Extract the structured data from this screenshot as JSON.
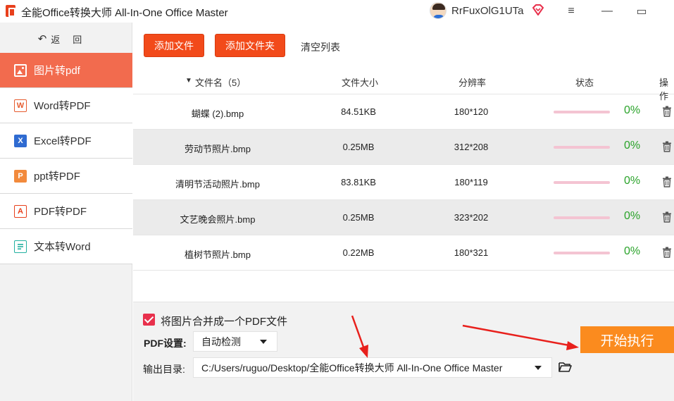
{
  "window": {
    "title": "全能Office转换大师 All-In-One Office Master",
    "username": "RrFuxOlG1UTa",
    "menu_icon": "≡",
    "minimize_icon": "—",
    "maximize_icon": "▭"
  },
  "sidebar": {
    "back_icon": "↶",
    "back_label": "返回",
    "items": [
      {
        "label": "图片转pdf",
        "icon": "image-icon",
        "color": "#ffffff",
        "active": true
      },
      {
        "label": "Word转PDF",
        "icon": "word-icon",
        "icon_text": "W",
        "color": "#e65c2f",
        "active": false
      },
      {
        "label": "Excel转PDF",
        "icon": "excel-icon",
        "icon_text": "X",
        "color": "#2f6bd1",
        "active": false
      },
      {
        "label": "ppt转PDF",
        "icon": "ppt-icon",
        "icon_text": "P",
        "color": "#f28a3c",
        "active": false
      },
      {
        "label": "PDF转PDF",
        "icon": "pdf-icon",
        "icon_text": "A",
        "color": "#e8401c",
        "active": false
      },
      {
        "label": "文本转Word",
        "icon": "text-icon",
        "icon_text": "",
        "color": "#22b0a0",
        "active": false
      }
    ]
  },
  "toolbar": {
    "add_file": "添加文件",
    "add_folder": "添加文件夹",
    "clear_list": "清空列表"
  },
  "table": {
    "sort_icon": "▼",
    "columns": {
      "name": "文件名（5）",
      "size": "文件大小",
      "resolution": "分辨率",
      "status": "状态",
      "action": "操作"
    },
    "rows": [
      {
        "name": "蝴蝶 (2).bmp",
        "size": "84.51KB",
        "resolution": "180*120",
        "progress": 0,
        "percent": "0%"
      },
      {
        "name": "劳动节照片.bmp",
        "size": "0.25MB",
        "resolution": "312*208",
        "progress": 0,
        "percent": "0%"
      },
      {
        "name": "清明节活动照片.bmp",
        "size": "83.81KB",
        "resolution": "180*119",
        "progress": 0,
        "percent": "0%"
      },
      {
        "name": "文艺晚会照片.bmp",
        "size": "0.25MB",
        "resolution": "323*202",
        "progress": 0,
        "percent": "0%"
      },
      {
        "name": "植树节照片.bmp",
        "size": "0.22MB",
        "resolution": "180*321",
        "progress": 0,
        "percent": "0%"
      }
    ]
  },
  "settings": {
    "merge_checked": true,
    "merge_label": "将图片合并成一个PDF文件",
    "pdf_label": "PDF设置:",
    "pdf_value": "自动检测",
    "output_label": "输出目录:",
    "output_value": "C:/Users/ruguo/Desktop/全能Office转换大师 All-In-One Office Master"
  },
  "start_button": "开始执行",
  "colors": {
    "accent": "#f24a1a",
    "sidebar_active": "#f26b4e",
    "start": "#fb8b1e",
    "success": "#2aa32a",
    "progress_track": "#f4c4d2",
    "arrow": "#e8201c"
  }
}
